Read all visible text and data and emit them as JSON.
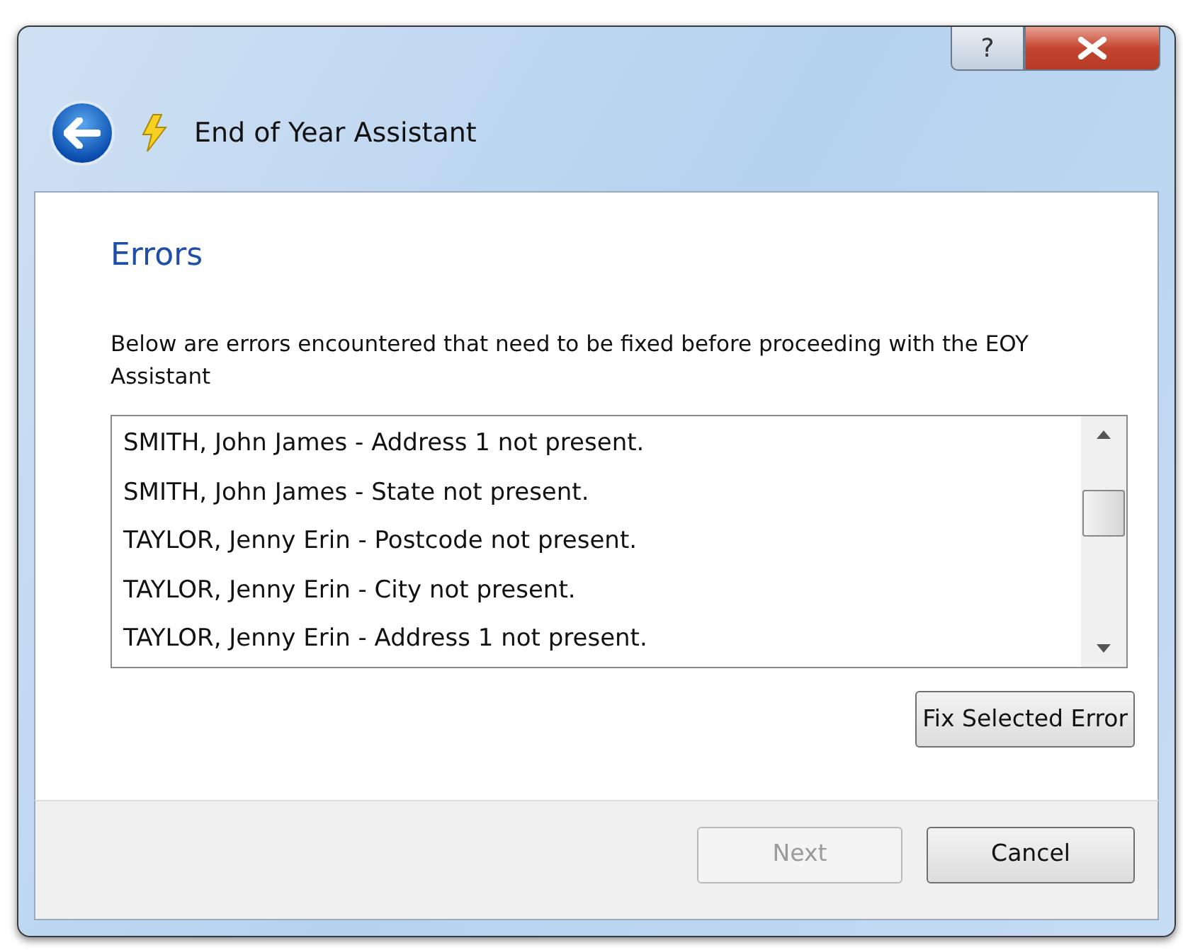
{
  "window": {
    "title": "End of Year Assistant",
    "help_button": "?"
  },
  "page": {
    "heading": "Errors",
    "description": "Below are errors encountered that need to be fixed before proceeding with the EOY Assistant"
  },
  "errors": [
    {
      "text": "SMITH, John James - Address 1 not present."
    },
    {
      "text": "SMITH, John James - State not present."
    },
    {
      "text": "TAYLOR, Jenny Erin - Postcode not present."
    },
    {
      "text": "TAYLOR, Jenny Erin - City not present."
    },
    {
      "text": "TAYLOR, Jenny Erin - Address 1 not present."
    }
  ],
  "fix_button": {
    "label": "Fix Selected Error",
    "disabled": false
  },
  "buttons": [
    {
      "label": "Next",
      "disabled": true
    },
    {
      "label": "Cancel",
      "disabled": false
    }
  ]
}
